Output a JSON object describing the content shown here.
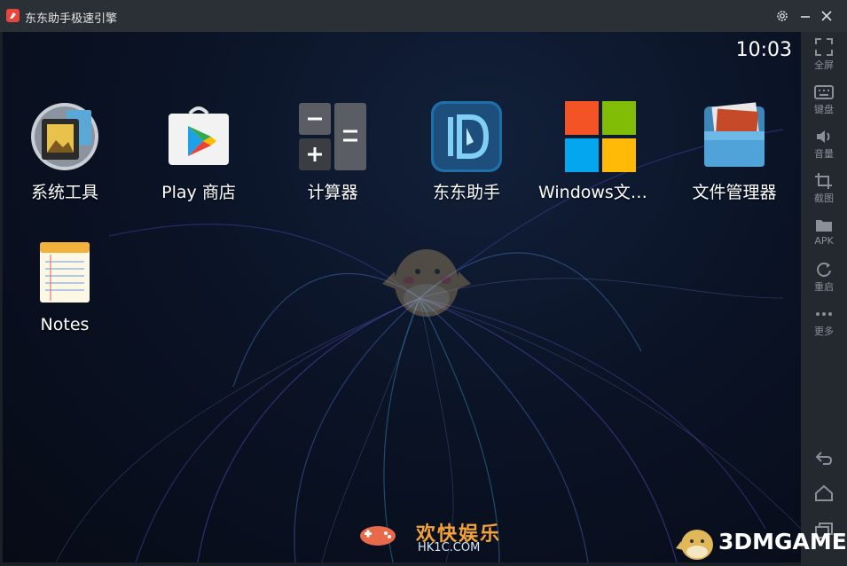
{
  "window": {
    "title": "东东助手极速引擎"
  },
  "status": {
    "time": "10:03"
  },
  "apps": [
    {
      "label": "系统工具"
    },
    {
      "label": "Play 商店"
    },
    {
      "label": "计算器"
    },
    {
      "label": "东东助手"
    },
    {
      "label": "Windows文件…"
    },
    {
      "label": "文件管理器"
    },
    {
      "label": "Notes"
    }
  ],
  "sidebar": {
    "items": [
      {
        "label": "全屏",
        "icon": "fullscreen-icon"
      },
      {
        "label": "键盘",
        "icon": "keyboard-icon"
      },
      {
        "label": "音量",
        "icon": "volume-icon"
      },
      {
        "label": "截图",
        "icon": "crop-icon"
      },
      {
        "label": "APK",
        "icon": "folder-icon"
      },
      {
        "label": "重启",
        "icon": "restart-icon"
      },
      {
        "label": "更多",
        "icon": "more-icon"
      }
    ]
  },
  "watermarks": {
    "hk_text": "欢快娱乐",
    "hk_url": "HK1C.COM",
    "brand": "3DMGAME"
  },
  "colors": {
    "titlebar": "#2b2f36",
    "sidebar": "#24282f",
    "accent": "#e8453c"
  }
}
